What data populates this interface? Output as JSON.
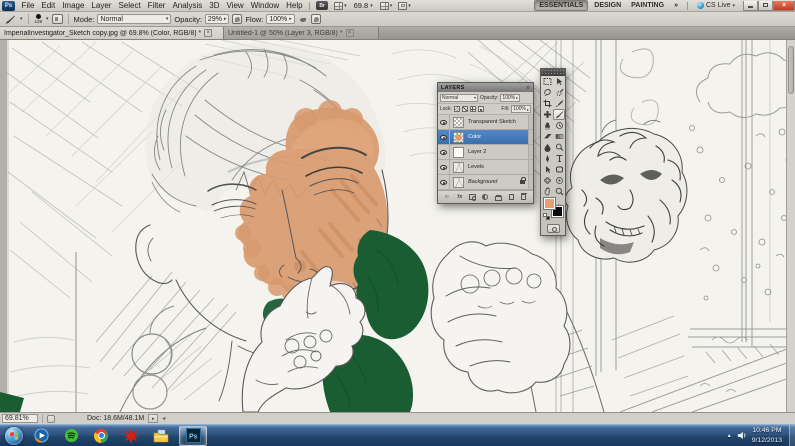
{
  "window": {
    "logo": "Ps"
  },
  "menu": {
    "items": [
      "File",
      "Edit",
      "Image",
      "Layer",
      "Select",
      "Filter",
      "Analysis",
      "3D",
      "View",
      "Window",
      "Help"
    ]
  },
  "app_bar": {
    "bridge_label": "Br",
    "zoom_level": "69.8"
  },
  "workspace_switcher": {
    "items": [
      "ESSENTIALS",
      "DESIGN",
      "PAINTING"
    ],
    "active": "ESSENTIALS",
    "overflow": "»",
    "cs_live": "CS Live"
  },
  "options_bar": {
    "brush_size": "129",
    "mode_label": "Mode:",
    "mode_value": "Normal",
    "opacity_label": "Opacity:",
    "opacity_value": "29%",
    "flow_label": "Flow:",
    "flow_value": "100%"
  },
  "document_tabs": [
    {
      "title": "ImperialInvestigator_Sketch copy.jpg @ 69.8% (Color, RGB/8) *",
      "active": true
    },
    {
      "title": "Untitled-1 @ 50% (Layer 3, RGB/8) *",
      "active": false
    }
  ],
  "layers_panel": {
    "title": "LAYERS",
    "blend_mode": "Normal",
    "opacity_label": "Opacity:",
    "opacity_value": "100%",
    "lock_label": "Lock:",
    "fill_label": "Fill:",
    "fill_value": "100%",
    "fx_label": "fx",
    "layers": [
      {
        "name": "Transparent Sketch",
        "selected": false
      },
      {
        "name": "Color",
        "selected": true
      },
      {
        "name": "Layer 2",
        "selected": false
      },
      {
        "name": "Levels",
        "selected": false
      },
      {
        "name": "Background",
        "selected": false,
        "locked": true
      }
    ],
    "bottom_icons": [
      "link",
      "layer-style-fx",
      "add-layer-mask",
      "new-adjustment-layer",
      "new-group",
      "new-layer",
      "delete-layer"
    ]
  },
  "tools_panel": {
    "tools": [
      "rectangular-marquee",
      "move",
      "lasso",
      "quick-selection",
      "crop",
      "eyedropper",
      "spot-healing-brush",
      "brush",
      "clone-stamp",
      "history-brush",
      "eraser",
      "gradient",
      "blur",
      "dodge",
      "pen",
      "type",
      "path-selection",
      "shape",
      "3d-object-rotate",
      "3d-camera-rotate",
      "hand",
      "zoom"
    ],
    "active_tool": "brush",
    "foreground_color": "#e79d72",
    "background_color": "#0a0a0a"
  },
  "status_bar": {
    "zoom_value": "69.81%",
    "doc_info": "Doc: 18.6M/48.1M"
  },
  "taskbar": {
    "apps": [
      "start",
      "windows-media-player",
      "spotify",
      "chrome",
      "red-app",
      "windows-explorer",
      "photoshop"
    ],
    "active_app": "photoshop",
    "tray_time": "10:46 PM",
    "tray_date": "9/12/2013"
  },
  "artwork": {
    "description": "Pencil sketch of a man with closed eyes and hand at chin, holding a small sculpted head; face partially painted with skin tone, dark green scarf",
    "skin_color": "#d89a6f",
    "scarf_color": "#1a5d33",
    "paper_color": "#f4f3ee"
  },
  "glyphs": {
    "dropdown": "▾",
    "flyout": "▸",
    "close": "×",
    "panel_menu": "≡",
    "tray_up": "▴",
    "left_small": "◂",
    "right_small": "▸",
    "link": "∞"
  }
}
